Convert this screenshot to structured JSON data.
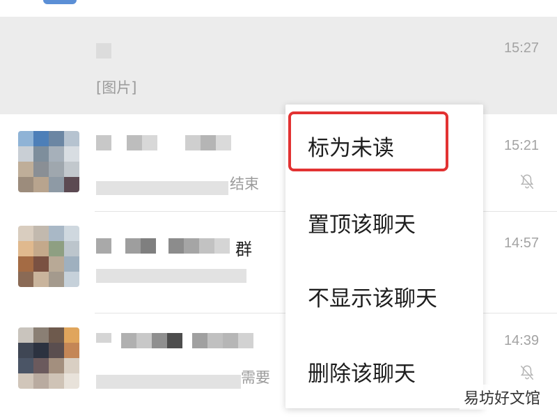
{
  "chats": [
    {
      "time": "15:27",
      "preview": "[图片]"
    },
    {
      "time": "15:21",
      "preview_suffix": "结束",
      "muted": true
    },
    {
      "time": "14:57",
      "name_suffix": "群"
    },
    {
      "time": "14:39",
      "preview_suffix": "需要",
      "muted": true
    }
  ],
  "context_menu": {
    "items": [
      "标为未读",
      "置顶该聊天",
      "不显示该聊天",
      "删除该聊天"
    ],
    "highlighted_index": 0,
    "highlight_color": "#e23232"
  },
  "watermark": "易坊好文馆",
  "icons": {
    "mute": "bell-slash-icon"
  }
}
